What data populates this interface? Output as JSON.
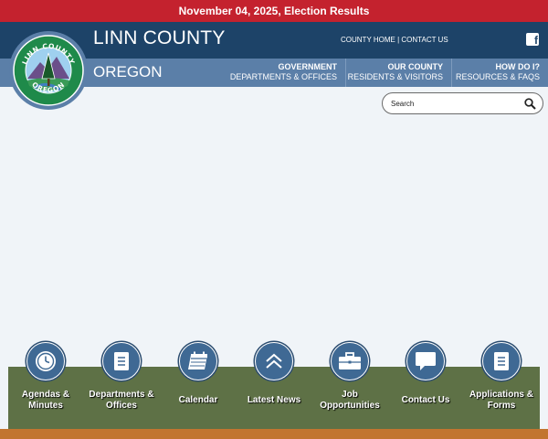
{
  "alert": {
    "text": "November 04, 2025, Election Results"
  },
  "header": {
    "county": "LINN COUNTY",
    "state": "OREGON",
    "links": [
      "COUNTY HOME",
      "CONTACT US"
    ],
    "separator": "|",
    "facebook_glyph": "f",
    "logo_text": "LINN COUNTY OREGON"
  },
  "nav": [
    {
      "title": "GOVERNMENT",
      "sub": "DEPARTMENTS & OFFICES"
    },
    {
      "title": "OUR COUNTY",
      "sub": "RESIDENTS & VISITORS"
    },
    {
      "title": "HOW DO I?",
      "sub": "RESOURCES & FAQS"
    }
  ],
  "search": {
    "placeholder": "Search"
  },
  "quicklinks": [
    {
      "label": "Agendas & Minutes",
      "icon": "clock-icon"
    },
    {
      "label": "Departments & Offices",
      "icon": "document-icon"
    },
    {
      "label": "Calendar",
      "icon": "calendar-icon"
    },
    {
      "label": "Latest News",
      "icon": "chevron-up-icon"
    },
    {
      "label": "Job Opportunities",
      "icon": "briefcase-icon"
    },
    {
      "label": "Contact Us",
      "icon": "speech-bubble-icon"
    },
    {
      "label": "Applications & Forms",
      "icon": "form-icon"
    }
  ],
  "colors": {
    "alert": "#c4222e",
    "header": "#1d4368",
    "nav": "#5b7fa8",
    "quicklinks_bg": "#5e7146",
    "footer_strip": "#c27530",
    "icon_circle": "#3f6994"
  }
}
